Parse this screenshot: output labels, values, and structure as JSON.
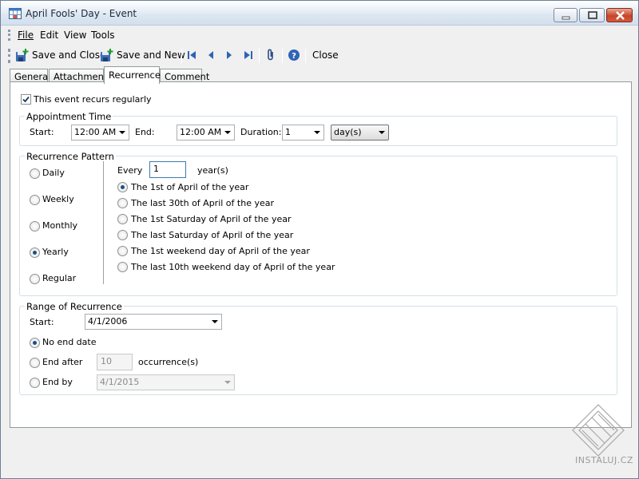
{
  "window": {
    "title": "April Fools' Day - Event"
  },
  "menu": [
    "File",
    "Edit",
    "View",
    "Tools"
  ],
  "toolbar": {
    "save_close": "Save and Close",
    "save_new": "Save and New",
    "close": "Close"
  },
  "tabs": [
    "General",
    "Attachments",
    "Recurrence",
    "Comment"
  ],
  "active_tab": "Recurrence",
  "recurs_checkbox": {
    "label": "This event recurs regularly",
    "checked": true
  },
  "appointment": {
    "title": "Appointment Time",
    "start_label": "Start:",
    "start_value": "12:00 AM",
    "end_label": "End:",
    "end_value": "12:00 AM",
    "duration_label": "Duration:",
    "duration_value": "1",
    "duration_unit": "day(s)"
  },
  "pattern": {
    "title": "Recurrence Pattern",
    "types": [
      "Daily",
      "Weekly",
      "Monthly",
      "Yearly",
      "Regular"
    ],
    "selected_type": "Yearly",
    "every_label": "Every",
    "every_value": "1",
    "every_unit": "year(s)",
    "options": [
      "The 1st of April of the year",
      "The last 30th of April of the year",
      "The 1st Saturday of April of the year",
      "The last Saturday of April of the year",
      "The 1st weekend day of April of the year",
      "The last 10th weekend day of April of the year"
    ],
    "selected_option": 0
  },
  "range": {
    "title": "Range of Recurrence",
    "start_label": "Start:",
    "start_value": "4/1/2006",
    "no_end": "No end date",
    "end_after": "End after",
    "end_after_value": "10",
    "occurrences": "occurrence(s)",
    "end_by": "End by",
    "end_by_value": "4/1/2015",
    "selected": "no_end"
  },
  "watermark": "INSTALUJ.CZ",
  "colors": {
    "title_bar": "#dde7f2",
    "close_button": "#c7452a",
    "radio_dot": "#1b4f8a"
  }
}
